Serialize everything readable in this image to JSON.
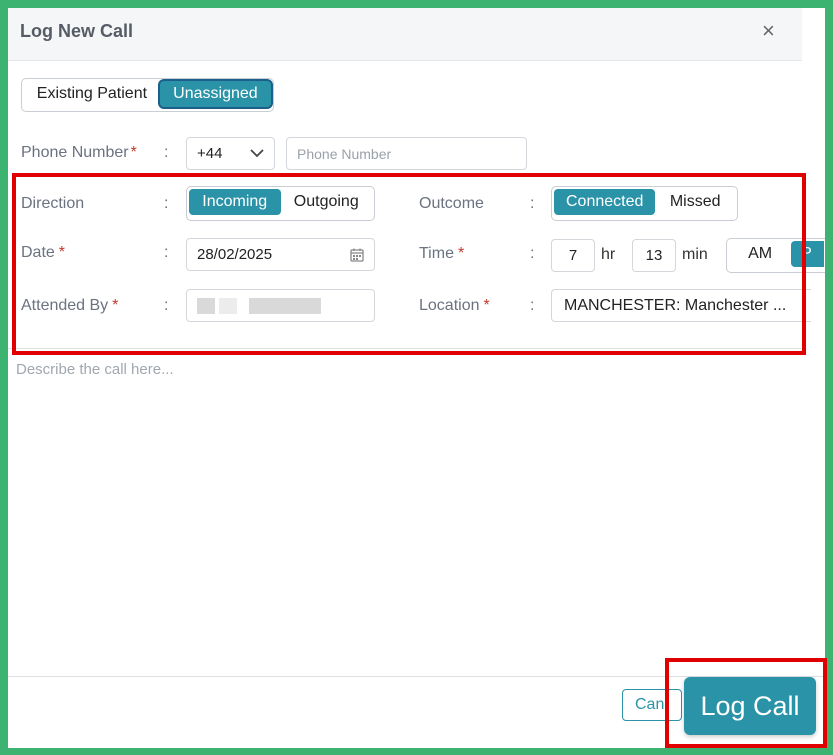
{
  "modal": {
    "title": "Log New Call",
    "close_icon": "×"
  },
  "patient_toggle": {
    "existing": "Existing Patient",
    "unassigned": "Unassigned",
    "selected": "Unassigned"
  },
  "phone": {
    "label": "Phone Number",
    "required": "*",
    "country_code": "+44",
    "placeholder": "Phone Number"
  },
  "direction": {
    "label": "Direction",
    "options": [
      "Incoming",
      "Outgoing"
    ],
    "selected": "Incoming"
  },
  "outcome": {
    "label": "Outcome",
    "options": [
      "Connected",
      "Missed"
    ],
    "selected": "Connected"
  },
  "date": {
    "label": "Date",
    "required": "*",
    "value": "28/02/2025"
  },
  "time": {
    "label": "Time",
    "required": "*",
    "hour": "7",
    "hour_unit": "hr",
    "minute": "13",
    "minute_unit": "min",
    "am": "AM",
    "pm": "P"
  },
  "attended_by": {
    "label": "Attended By",
    "required": "*"
  },
  "location": {
    "label": "Location",
    "required": "*",
    "value": "MANCHESTER: Manchester ..."
  },
  "description": {
    "placeholder": "Describe the call here..."
  },
  "footer": {
    "cancel": "Can",
    "log_call": "Log Call"
  },
  "colors": {
    "accent": "#2a93a8",
    "required": "#c0392b",
    "highlight": "#e00000",
    "frame": "#3cb371"
  }
}
